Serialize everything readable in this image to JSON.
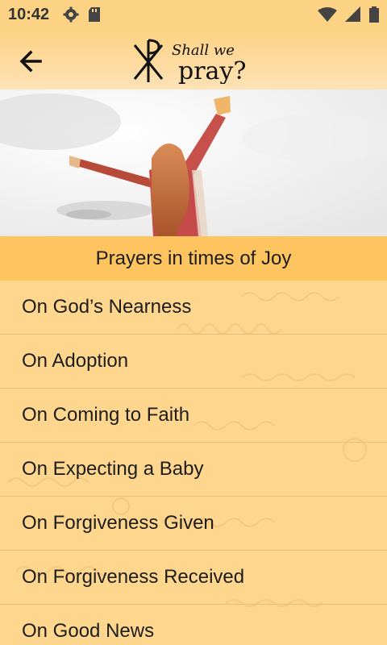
{
  "status_bar": {
    "time": "10:42",
    "left_icons": [
      "gear-icon",
      "sd-card-icon"
    ],
    "right_icons": [
      "wifi-icon",
      "signal-icon",
      "battery-icon"
    ]
  },
  "app_bar": {
    "back_icon": "back-arrow-icon",
    "logo_line1": "Shall we",
    "logo_line2": "pray?"
  },
  "section": {
    "title": "Prayers in times of Joy"
  },
  "prayers": [
    "On God’s Nearness",
    "On Adoption",
    "On Coming to Faith",
    "On Expecting a Baby",
    "On Forgiveness Given",
    "On Forgiveness Received",
    "On Good News"
  ],
  "colors": {
    "app_bar": "#fdd283",
    "header": "#fdc45f",
    "list_bg": "#ffd68e",
    "divider": "#e5bf7c"
  }
}
